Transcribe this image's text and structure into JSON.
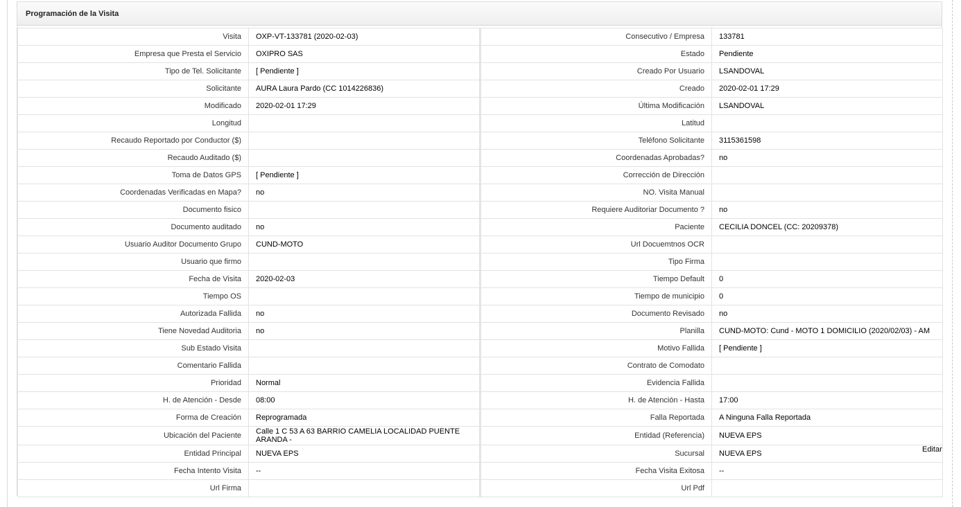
{
  "panel": {
    "title": "Programación de la Visita",
    "edit_label": "Editar"
  },
  "rows": [
    {
      "l1": "Visita",
      "v1": "OXP-VT-133781 (2020-02-03)",
      "l2": "Consecutivo / Empresa",
      "v2": "133781"
    },
    {
      "l1": "Empresa que Presta el Servicio",
      "v1": "OXIPRO SAS",
      "l2": "Estado",
      "v2": "Pendiente"
    },
    {
      "l1": "Tipo de Tel. Solicitante",
      "v1": "[ Pendiente ]",
      "l2": "Creado Por Usuario",
      "v2": "LSANDOVAL"
    },
    {
      "l1": "Solicitante",
      "v1": "AURA Laura Pardo (CC 1014226836)",
      "l2": "Creado",
      "v2": "2020-02-01 17:29"
    },
    {
      "l1": "Modificado",
      "v1": "2020-02-01 17:29",
      "l2": "Última Modificación",
      "v2": " LSANDOVAL"
    },
    {
      "l1": "Longitud",
      "v1": "",
      "l2": "Latitud",
      "v2": ""
    },
    {
      "l1": "Recaudo Reportado por Conductor ($)",
      "v1": "",
      "l2": "Teléfono Solicitante",
      "v2": "3115361598"
    },
    {
      "l1": "Recaudo Auditado ($)",
      "v1": "",
      "l2": "Coordenadas Aprobadas?",
      "v2": " no"
    },
    {
      "l1": "Toma de Datos GPS",
      "v1": "[ Pendiente ]",
      "l2": "Corrección de Dirección",
      "v2": ""
    },
    {
      "l1": "Coordenadas Verificadas en Mapa?",
      "v1": " no",
      "l2": "NO. Visita Manual",
      "v2": ""
    },
    {
      "l1": "Documento fisico",
      "v1": "",
      "l2": "Requiere Auditoriar Documento ?",
      "v2": " no"
    },
    {
      "l1": "Documento auditado",
      "v1": " no",
      "l2": "Paciente",
      "v2": "CECILIA DONCEL (CC: 20209378)"
    },
    {
      "l1": "Usuario Auditor Documento Grupo",
      "v1": "CUND-MOTO",
      "l2": "Url Docuemtnos OCR",
      "v2": ""
    },
    {
      "l1": "Usuario que firmo",
      "v1": "",
      "l2": "Tipo Firma",
      "v2": ""
    },
    {
      "l1": "Fecha de Visita",
      "v1": " 2020-02-03",
      "l2": "Tiempo Default",
      "v2": "0"
    },
    {
      "l1": "Tiempo OS",
      "v1": "",
      "l2": "Tiempo de municipio",
      "v2": "0"
    },
    {
      "l1": "Autorizada Fallida",
      "v1": " no",
      "l2": "Documento Revisado",
      "v2": " no"
    },
    {
      "l1": "Tiene Novedad Auditoria",
      "v1": " no",
      "l2": "Planilla",
      "v2": "CUND-MOTO: Cund - MOTO 1 DOMICILIO (2020/02/03) - AM"
    },
    {
      "l1": "Sub Estado Visita",
      "v1": "",
      "l2": "Motivo Fallida",
      "v2": "[ Pendiente ]"
    },
    {
      "l1": "Comentario Fallida",
      "v1": "",
      "l2": "Contrato de Comodato",
      "v2": ""
    },
    {
      "l1": "Prioridad",
      "v1": "Normal",
      "l2": "Evidencia Fallida",
      "v2": ""
    },
    {
      "l1": "H. de Atención - Desde",
      "v1": "08:00",
      "l2": "H. de Atención - Hasta",
      "v2": "17:00"
    },
    {
      "l1": "Forma de Creación",
      "v1": "Reprogramada",
      "l2": "Falla Reportada",
      "v2": "A Ninguna Falla Reportada"
    },
    {
      "l1": "Ubicación del Paciente",
      "v1": "Calle 1 C 53 A 63 BARRIO CAMELIA LOCALIDAD PUENTE ARANDA -",
      "l2": "Entidad (Referencia)",
      "v2": "NUEVA EPS"
    },
    {
      "l1": "Entidad Principal",
      "v1": "NUEVA EPS",
      "l2": "Sucursal",
      "v2": "NUEVA EPS"
    },
    {
      "l1": "Fecha Intento Visita",
      "v1": "--",
      "l2": "Fecha Visita Exitosa",
      "v2": "--"
    },
    {
      "l1": "Url Firma",
      "v1": "",
      "l2": "Url Pdf",
      "v2": ""
    }
  ]
}
